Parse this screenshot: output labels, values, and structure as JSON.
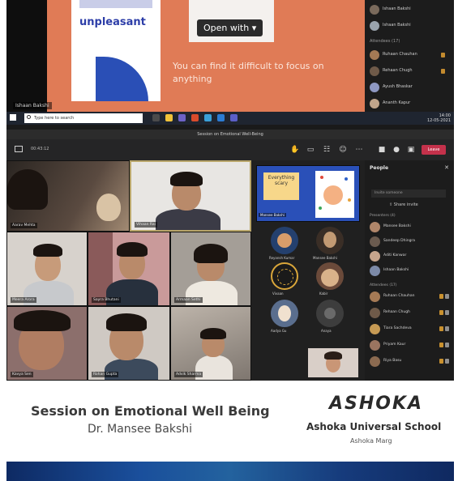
{
  "screen_share": {
    "slide_word": "unpleasant",
    "open_with_label": "Open with",
    "slide_text": "You can find it difficult to focus on anything",
    "presenter_label": "Ishaan Bakshi"
  },
  "top_panel": {
    "people": [
      {
        "name": "Ishaan Bakshi"
      },
      {
        "name": "Ishaan Bakshi"
      }
    ],
    "section_label": "Attendees (17)",
    "attendees": [
      {
        "name": "Ruhaan Chauhan"
      },
      {
        "name": "Rehaan Chugh"
      },
      {
        "name": "Ayush Bhaskar"
      },
      {
        "name": "Ananth Kapur"
      }
    ]
  },
  "taskbar": {
    "search_placeholder": "Type here to search",
    "clock_time": "14:00",
    "clock_date": "12-05-2021"
  },
  "meeting": {
    "window_title": "Session on Emotional Well-Being",
    "elapsed": "00:43:12",
    "leave_label": "Leave",
    "tiles": [
      {
        "name": "Aarav Mehta"
      },
      {
        "name": "Vihaan Rai"
      },
      {
        "name": "Meera Arora"
      },
      {
        "name": "Sayra Bhutani"
      },
      {
        "name": "Armaan Sethi"
      },
      {
        "name": "Kavya Sen"
      },
      {
        "name": "Rohan Gupta"
      },
      {
        "name": "Advik Sharma"
      }
    ],
    "pinned": {
      "note_text": "Everything scary",
      "label": "Mansee Bakshi"
    },
    "round_tiles": [
      {
        "name": "Reyansh Kumar"
      },
      {
        "name": "Mansee Bakshi"
      },
      {
        "name": "Vivaan"
      },
      {
        "name": "Kabir"
      },
      {
        "name": "Aadya Gu"
      },
      {
        "name": "Anaya"
      }
    ],
    "roster": {
      "title": "People",
      "invite_placeholder": "Invite someone",
      "share_label": "Share invite",
      "organizers_label": "Presenters (4)",
      "presenters": [
        {
          "name": "Mansee Bakshi"
        },
        {
          "name": "Sandeep Dhingra"
        },
        {
          "name": "Aditi Kanwar"
        },
        {
          "name": "Ishaan Bakshi"
        }
      ],
      "attendees_label": "Attendees (17)",
      "attendees": [
        {
          "name": "Ruhaan Chauhan"
        },
        {
          "name": "Rehaan Chugh"
        },
        {
          "name": "Tiara Sachdeva"
        },
        {
          "name": "Priyam Kaur"
        },
        {
          "name": "Riya Basu"
        }
      ]
    }
  },
  "banner": {
    "session_title": "Session on Emotional Well Being",
    "speaker": "Dr. Mansee Bakshi",
    "logo_text": "ASHOKA",
    "school_name": "Ashoka Universal School",
    "school_location": "Ashoka Marg"
  },
  "colors": {
    "slide_orange": "#e07b56",
    "teams_dark": "#202020",
    "leave_red": "#c4314b",
    "banner_blue": "#1a4f9c"
  }
}
